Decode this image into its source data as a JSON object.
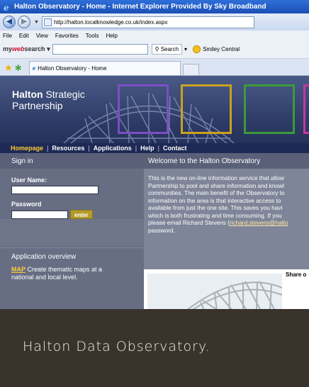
{
  "browser": {
    "window_title": "Halton Observatory - Home - Internet Explorer Provided By Sky Broadband",
    "address": "http://halton.localknowledge.co.uk/index.aspx",
    "menu": [
      "File",
      "Edit",
      "View",
      "Favorites",
      "Tools",
      "Help"
    ],
    "mywebsearch_logo_prefix": "my",
    "mywebsearch_logo_accent": "web",
    "mywebsearch_logo_suffix": "search",
    "search_label": "Search",
    "smiley_label": "Smiley Central",
    "tab_title": "Halton Observatory - Home"
  },
  "banner": {
    "title_bold": "Halton",
    "title_rest": "Strategic",
    "title_line2": "Partnership",
    "square_colors": [
      "#7b4fc4",
      "#c9a21f",
      "#3c9a3c",
      "#c23aa5"
    ]
  },
  "nav": {
    "items": [
      "Homepage",
      "Resources",
      "Applications",
      "Help",
      "Contact"
    ],
    "separator": "|"
  },
  "sidebar": {
    "signin_heading": "Sign in",
    "username_label": "User Name:",
    "password_label": "Password",
    "enter_label": "enter",
    "app_overview_heading": "Application overview",
    "map_link": "MAP",
    "map_desc_1": " Create thematic maps at a",
    "map_desc_2": "national and local level."
  },
  "main": {
    "welcome_heading": "Welcome to the Halton Observatory",
    "lines": [
      "This is the new on-line information service that allow",
      "Partnership to pool and share information and knowl",
      "communities. The main benefit of the Observatory to",
      "information on the area is that interactive access to",
      "available from just the one site. This saves you havi",
      "which is both frustrating and time consuming. If you",
      "please email Richard Stevens ("
    ],
    "email_link": "richard.stevens@halto",
    "last_line": "password.",
    "share_label": "Share o"
  },
  "footer": {
    "caption": "Halton Data Observatory."
  },
  "colors": {
    "titlebar": "#1f57c3",
    "banner": "#2d3a66",
    "sidebar": "#676e84",
    "enter_button": "#b49b2b",
    "footer": "#3a332c"
  }
}
